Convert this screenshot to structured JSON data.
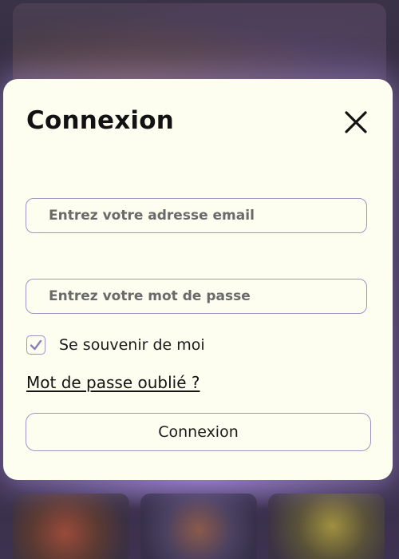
{
  "modal": {
    "title": "Connexion",
    "close_icon": "close-icon",
    "email": {
      "placeholder": "Entrez votre adresse email",
      "value": ""
    },
    "password": {
      "placeholder": "Entrez votre mot de passe",
      "value": ""
    },
    "remember": {
      "label": "Se souvenir de moi",
      "checked": true,
      "icon": "check-icon"
    },
    "forgot_password_label": "Mot de passe oublié ?",
    "submit_label": "Connexion"
  },
  "colors": {
    "modal_background": "#fdfdf0",
    "border_accent": "#9e95c7",
    "text": "#121212",
    "backdrop_glow": "#b496f0"
  }
}
